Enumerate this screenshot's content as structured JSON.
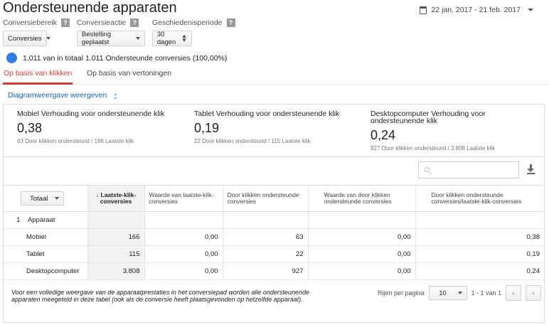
{
  "page": {
    "title": "Ondersteunende apparaten"
  },
  "daterange": {
    "label": "22 jan. 2017 - 21 feb. 2017"
  },
  "filters": [
    {
      "label": "Conversiebereik",
      "value": "Conversies"
    },
    {
      "label": "Conversieactie",
      "value": "Bestelling geplaatst"
    },
    {
      "label": "Geschiedenisperiode",
      "value": "30 dagen"
    }
  ],
  "help_glyph": "?",
  "summary": {
    "text": "1.011 van in totaal 1.011 Ondersteunde conversies (100,00%)",
    "color": "#2d7ee0"
  },
  "tabs": [
    {
      "label": "Op basis van klikken",
      "active": true
    },
    {
      "label": "Op basis van vertoningen",
      "active": false
    }
  ],
  "diagram_link": "Diagramweergave weergeven",
  "metrics": [
    {
      "label": "Mobiel Verhouding voor ondersteunende klik",
      "value": "0,38",
      "sub": "63 Door klikken ondersteund / 166 Laatste klik"
    },
    {
      "label": "Tablet Verhouding voor ondersteunende klik",
      "value": "0,19",
      "sub": "22 Door klikken ondersteund / 115 Laatste klik"
    },
    {
      "label": "Desktopcomputer Verhouding voor ondersteunende klik",
      "value": "0,24",
      "sub": "927 Door klikken ondersteund / 3.808 Laatste klik"
    }
  ],
  "table": {
    "group_select": "Totaal",
    "sort_arrow": "↓",
    "headers": [
      "Laatste-klik-conversies",
      "Waarde van laatste-klik-conversies",
      "Door klikken ondersteunde conversies",
      "Waarde van door klikken ondersteunde conversies",
      "Door klikken ondersteunde conversies/laatste-klik-conversies"
    ],
    "group_row": {
      "index": "1",
      "label": "Apparaat"
    },
    "rows": [
      {
        "name": "Mobiel",
        "cells": [
          "166",
          "0,00",
          "63",
          "0,00",
          "0,38"
        ]
      },
      {
        "name": "Tablet",
        "cells": [
          "115",
          "0,00",
          "22",
          "0,00",
          "0,19"
        ]
      },
      {
        "name": "Desktopcomputer",
        "cells": [
          "3.808",
          "0,00",
          "927",
          "0,00",
          "0,24"
        ]
      }
    ]
  },
  "footnote": "Voor een volledige weergave van de apparaatprestaties in het conversiepad worden alle ondersteunende apparaten meegeteld in deze tabel (ook als de conversie heeft plaatsgevonden op hetzelfde apparaat).",
  "pager": {
    "label": "Rijen per pagina",
    "per_page": "10",
    "range": "1 - 1 van 1",
    "prev": "‹",
    "next": "›"
  },
  "accent_color": "#d23f31"
}
